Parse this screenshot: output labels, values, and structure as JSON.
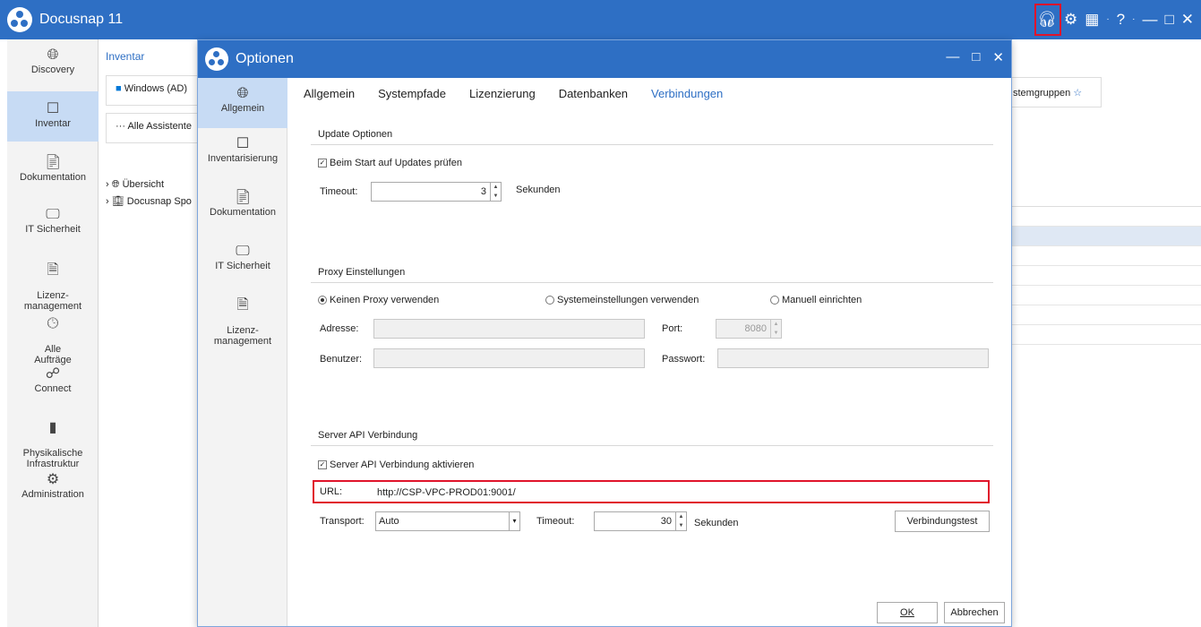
{
  "app": {
    "title": "Docusnap 11",
    "titlebar_icons": [
      "headset-icon",
      "gear-icon",
      "toolbar-icon",
      "help-icon",
      "minimize-icon",
      "maximize-icon",
      "close-icon"
    ],
    "accent_color": "#2e6fc4",
    "highlight_color": "#e0142b"
  },
  "left_nav": [
    {
      "label": "Discovery",
      "icon": "globe-icon"
    },
    {
      "label": "Inventar",
      "icon": "inventory-icon",
      "active": true
    },
    {
      "label": "Dokumentation",
      "icon": "documentation-icon"
    },
    {
      "label": "IT Sicherheit",
      "icon": "security-icon"
    },
    {
      "label": "Lizenz-\nmanagement",
      "icon": "license-icon"
    },
    {
      "label": "Alle\nAufträge",
      "icon": "clock-icon"
    },
    {
      "label": "Connect",
      "icon": "connect-icon"
    },
    {
      "label": "Physikalische\nInfrastruktur",
      "icon": "server-icon"
    },
    {
      "label": "Administration",
      "icon": "admin-gears-icon"
    }
  ],
  "background": {
    "tab": "Inventar",
    "card1": "Windows (AD)",
    "card2": "··· Alle Assistente",
    "tree": [
      "Übersicht",
      "Docusnap Spo"
    ],
    "right_card": "stemgruppen"
  },
  "dialog": {
    "title": "Optionen",
    "nav": [
      {
        "label": "Allgemein",
        "icon": "globe-icon",
        "active": true
      },
      {
        "label": "Inventarisierung",
        "icon": "inventory-icon"
      },
      {
        "label": "Dokumentation",
        "icon": "documentation-icon"
      },
      {
        "label": "IT Sicherheit",
        "icon": "security-icon"
      },
      {
        "label": "Lizenz-\nmanagement",
        "icon": "license-icon"
      }
    ],
    "tabs": [
      "Allgemein",
      "Systempfade",
      "Lizenzierung",
      "Datenbanken",
      "Verbindungen"
    ],
    "active_tab": "Verbindungen",
    "update": {
      "section": "Update Optionen",
      "check_label": "Beim Start auf Updates prüfen",
      "checked": true,
      "timeout_label": "Timeout:",
      "timeout_value": "3",
      "timeout_unit": "Sekunden"
    },
    "proxy": {
      "section": "Proxy Einstellungen",
      "options": [
        "Keinen Proxy verwenden",
        "Systemeinstellungen verwenden",
        "Manuell einrichten"
      ],
      "selected": "Keinen Proxy verwenden",
      "address_label": "Adresse:",
      "address_value": "",
      "port_label": "Port:",
      "port_value": "8080",
      "user_label": "Benutzer:",
      "user_value": "",
      "password_label": "Passwort:",
      "password_value": ""
    },
    "server_api": {
      "section": "Server API Verbindung",
      "check_label": "Server API Verbindung aktivieren",
      "checked": true,
      "url_label": "URL:",
      "url_value": "http://CSP-VPC-PROD01:9001/",
      "transport_label": "Transport:",
      "transport_value": "Auto",
      "timeout_label": "Timeout:",
      "timeout_value": "30",
      "timeout_unit": "Sekunden",
      "test_button": "Verbindungstest"
    },
    "buttons": {
      "ok": "OK",
      "cancel": "Abbrechen"
    }
  }
}
